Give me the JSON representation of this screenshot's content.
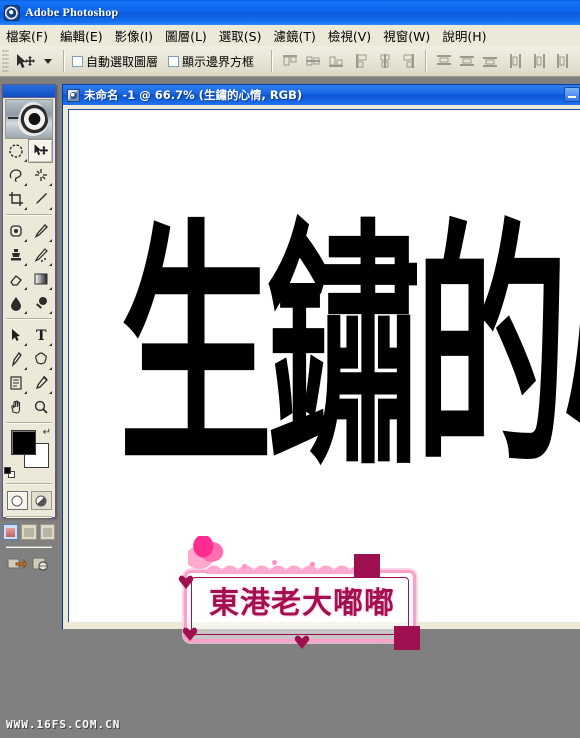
{
  "app": {
    "title": "Adobe Photoshop",
    "icon": "photoshop-icon"
  },
  "menubar": {
    "items": [
      {
        "label": "檔案(F)",
        "name": "menu-file"
      },
      {
        "label": "編輯(E)",
        "name": "menu-edit"
      },
      {
        "label": "影像(I)",
        "name": "menu-image"
      },
      {
        "label": "圖層(L)",
        "name": "menu-layer"
      },
      {
        "label": "選取(S)",
        "name": "menu-select"
      },
      {
        "label": "濾鏡(T)",
        "name": "menu-filter"
      },
      {
        "label": "檢視(V)",
        "name": "menu-view"
      },
      {
        "label": "視窗(W)",
        "name": "menu-window"
      },
      {
        "label": "說明(H)",
        "name": "menu-help"
      }
    ]
  },
  "options_bar": {
    "active_tool": "move-tool",
    "checkboxes": [
      {
        "label": "自動選取圖層",
        "checked": false
      },
      {
        "label": "顯示邊界方框",
        "checked": false
      }
    ],
    "align_buttons": [
      "align-top-edges",
      "align-vertical-centers",
      "align-bottom-edges",
      "align-left-edges",
      "align-horizontal-centers",
      "align-right-edges"
    ],
    "distribute_buttons": [
      "distribute-top-edges",
      "distribute-vertical-centers",
      "distribute-bottom-edges",
      "distribute-left-edges",
      "distribute-horizontal-centers",
      "distribute-right-edges"
    ],
    "buttons_enabled": false
  },
  "toolbox": {
    "tools": [
      {
        "name": "marquee-tool",
        "selected": false,
        "has_flyout": true
      },
      {
        "name": "move-tool",
        "selected": true,
        "has_flyout": false
      },
      {
        "name": "lasso-tool",
        "selected": false,
        "has_flyout": true
      },
      {
        "name": "magic-wand-tool",
        "selected": false,
        "has_flyout": true
      },
      {
        "name": "crop-tool",
        "selected": false,
        "has_flyout": false
      },
      {
        "name": "slice-tool",
        "selected": false,
        "has_flyout": true
      },
      {
        "name": "healing-brush-tool",
        "selected": false,
        "has_flyout": true
      },
      {
        "name": "paintbrush-tool",
        "selected": false,
        "has_flyout": true
      },
      {
        "name": "clone-stamp-tool",
        "selected": false,
        "has_flyout": true
      },
      {
        "name": "history-brush-tool",
        "selected": false,
        "has_flyout": true
      },
      {
        "name": "eraser-tool",
        "selected": false,
        "has_flyout": true
      },
      {
        "name": "gradient-tool",
        "selected": false,
        "has_flyout": true
      },
      {
        "name": "blur-tool",
        "selected": false,
        "has_flyout": true
      },
      {
        "name": "dodge-tool",
        "selected": false,
        "has_flyout": true
      },
      {
        "name": "path-selection-tool",
        "selected": false,
        "has_flyout": true
      },
      {
        "name": "type-tool",
        "selected": false,
        "has_flyout": true
      },
      {
        "name": "pen-tool",
        "selected": false,
        "has_flyout": true
      },
      {
        "name": "custom-shape-tool",
        "selected": false,
        "has_flyout": true
      },
      {
        "name": "notes-tool",
        "selected": false,
        "has_flyout": true
      },
      {
        "name": "eyedropper-tool",
        "selected": false,
        "has_flyout": true
      },
      {
        "name": "hand-tool",
        "selected": false,
        "has_flyout": false
      },
      {
        "name": "zoom-tool",
        "selected": false,
        "has_flyout": false
      }
    ],
    "colors": {
      "foreground": "#000000",
      "background": "#ffffff",
      "swap_icon": "swap-colors-icon",
      "default_icon": "default-colors-icon"
    },
    "mask_modes": [
      {
        "name": "standard-mode-button",
        "active": true
      },
      {
        "name": "quick-mask-mode-button",
        "active": false
      }
    ],
    "screen_modes": [
      {
        "name": "standard-screen-mode-button",
        "active": true
      },
      {
        "name": "full-screen-with-menubar-button",
        "active": false
      },
      {
        "name": "full-screen-mode-button",
        "active": false
      }
    ],
    "jump_buttons": [
      {
        "name": "jump-to-imageready-button"
      },
      {
        "name": "preview-in-browser-button"
      }
    ]
  },
  "document": {
    "title": "未命名 -1 @ 66.7% (生鏽的心情, RGB)",
    "filename": "未命名 -1",
    "zoom": "66.7%",
    "layer_name": "生鏽的心情",
    "color_mode": "RGB",
    "minimize_button": "minimize-button",
    "canvas": {
      "background": "#ffffff",
      "artwork_text": "生鏽的心情",
      "artwork_color": "#000000"
    }
  },
  "watermark": {
    "badge_text": "東港老大嘟嘟",
    "frame_color": "#ff9ec7",
    "text_color": "#a4104f",
    "site_url": "WWW.16FS.COM.CN"
  }
}
